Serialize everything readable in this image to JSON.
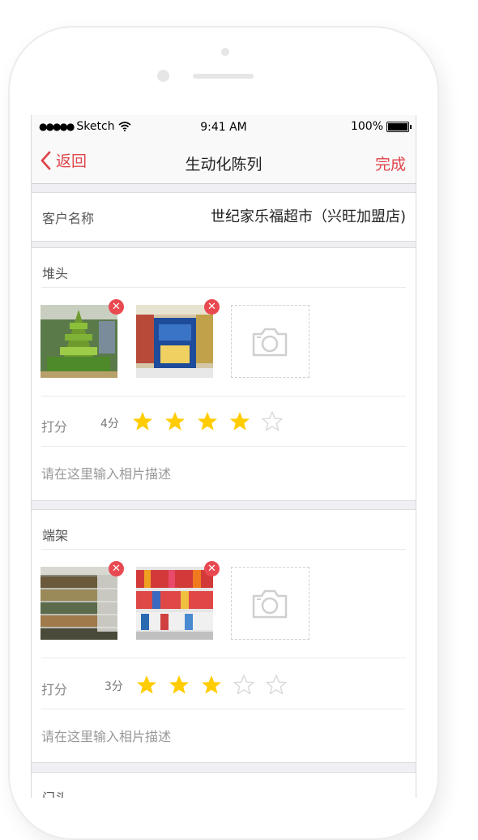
{
  "status_bar": {
    "signal": "●●●●●",
    "carrier": "Sketch",
    "time": "9:41 AM",
    "battery": "100%"
  },
  "nav": {
    "back": "返回",
    "title": "生动化陈列",
    "done": "完成"
  },
  "customer": {
    "label": "客户名称",
    "value": "世纪家乐福超市（兴旺加盟店)"
  },
  "sections": [
    {
      "title": "堆头",
      "score_label": "打分",
      "score_value": "4分",
      "rating": 4,
      "max": 5,
      "placeholder": "请在这里输入相片描述"
    },
    {
      "title": "端架",
      "score_label": "打分",
      "score_value": "3分",
      "rating": 3,
      "max": 5,
      "placeholder": "请在这里输入相片描述"
    },
    {
      "title": "门头"
    }
  ],
  "colors": {
    "accent": "#e0454b",
    "star_on": "#ffcc00",
    "star_off": "#d9d9d9"
  },
  "icons": {
    "back": "chevron-left-icon",
    "camera": "camera-icon",
    "delete": "close-icon",
    "star": "star-icon"
  }
}
